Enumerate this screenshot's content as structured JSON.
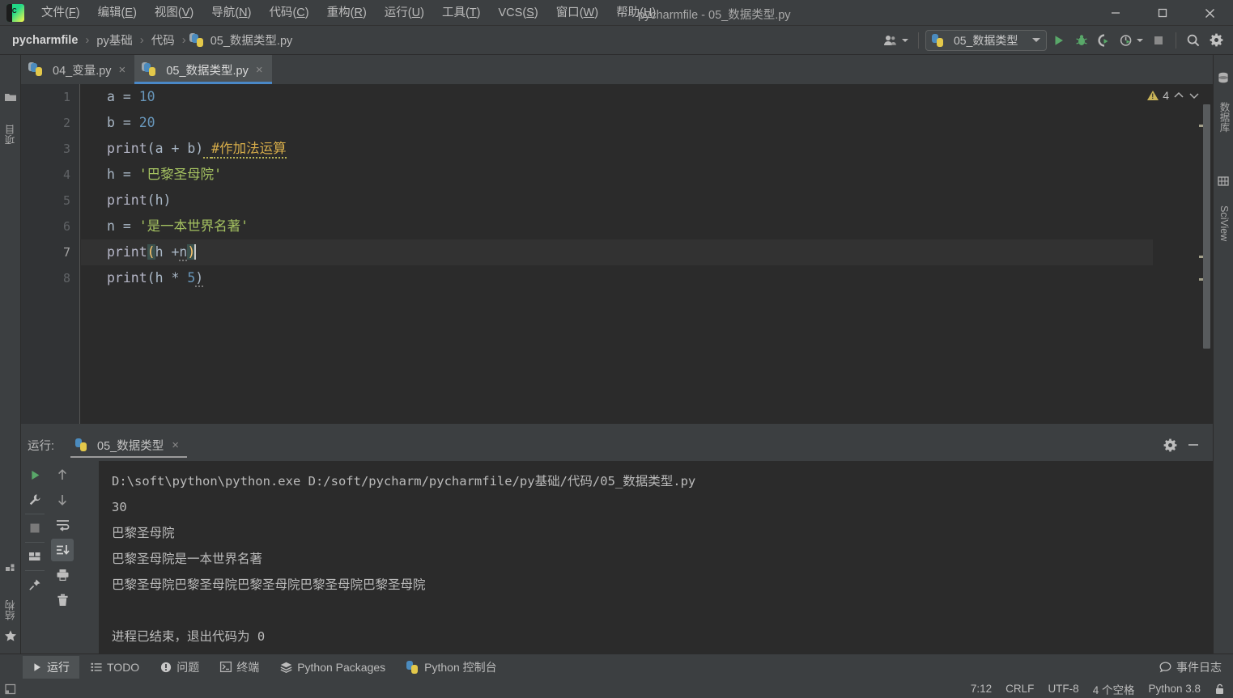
{
  "window": {
    "title": "pycharmfile - 05_数据类型.py",
    "app_icon": "pycharm-logo-icon",
    "controls": {
      "minimize": "minimize-icon",
      "maximize": "maximize-icon",
      "close": "close-icon"
    }
  },
  "menubar": {
    "items": [
      {
        "text": "文件",
        "mnemonic": "F"
      },
      {
        "text": "编辑",
        "mnemonic": "E"
      },
      {
        "text": "视图",
        "mnemonic": "V"
      },
      {
        "text": "导航",
        "mnemonic": "N"
      },
      {
        "text": "代码",
        "mnemonic": "C"
      },
      {
        "text": "重构",
        "mnemonic": "R"
      },
      {
        "text": "运行",
        "mnemonic": "U"
      },
      {
        "text": "工具",
        "mnemonic": "T"
      },
      {
        "text": "VCS",
        "mnemonic": "S"
      },
      {
        "text": "窗口",
        "mnemonic": "W"
      },
      {
        "text": "帮助",
        "mnemonic": "H"
      }
    ]
  },
  "breadcrumb": {
    "separator": "›",
    "items": [
      {
        "label": "pycharmfile",
        "root": true
      },
      {
        "label": "py基础",
        "root": false
      },
      {
        "label": "代码",
        "root": false
      },
      {
        "label": "05_数据类型.py",
        "root": false,
        "icon": "python-file-icon"
      }
    ]
  },
  "toolbar": {
    "account_icon": "user-account-icon",
    "run_config": {
      "label": "05_数据类型",
      "icon": "python-file-icon"
    },
    "run_icon": "run-play-icon",
    "debug_icon": "debug-bug-icon",
    "run_coverage_icon": "run-with-coverage-icon",
    "profile_icon": "profile-icon",
    "stop_icon": "stop-square-icon",
    "search_icon": "search-magnifier-icon",
    "settings_icon": "settings-gear-icon"
  },
  "left_strip": {
    "project_label": "项目",
    "project_icon": "project-folder-icon",
    "structure_label": "结构",
    "structure_icon": "structure-blocks-icon",
    "favorites_label": "收藏夹",
    "favorites_icon": "favorites-star-icon"
  },
  "right_strip": {
    "database_label": "数据库",
    "database_icon": "database-cylinder-icon",
    "sciview_label": "SciView",
    "sciview_icon": "sciview-grid-icon"
  },
  "editor_tabs": [
    {
      "label": "04_变量.py",
      "active": false,
      "icon": "python-file-icon",
      "close": "×"
    },
    {
      "label": "05_数据类型.py",
      "active": true,
      "icon": "python-file-icon",
      "close": "×"
    }
  ],
  "editor": {
    "line_numbers": [
      "1",
      "2",
      "3",
      "4",
      "5",
      "6",
      "7",
      "8"
    ],
    "current_line": 7,
    "inspection": {
      "warning_count": "4",
      "warning_icon": "warning-triangle-icon",
      "up_icon": "⌃",
      "down_icon": "⌄"
    },
    "lines": [
      {
        "n": 1,
        "raw": "a = 10"
      },
      {
        "n": 2,
        "raw": "b = 20"
      },
      {
        "n": 3,
        "raw": "print(a + b) #作加法运算"
      },
      {
        "n": 4,
        "raw": "h = '巴黎圣母院'"
      },
      {
        "n": 5,
        "raw": "print(h)"
      },
      {
        "n": 6,
        "raw": "n = '是一本世界名著'"
      },
      {
        "n": 7,
        "raw": "print(h +n)"
      },
      {
        "n": 8,
        "raw": "print(h * 5)"
      }
    ],
    "tokens": {
      "l1_var": "a",
      "l1_eq": " = ",
      "l1_num": "10",
      "l2_var": "b",
      "l2_eq": " = ",
      "l2_num": "20",
      "l3_fn": "print",
      "l3_args": "(a + b)",
      "l3_gap": " ",
      "l3_comment": "#作加法运算",
      "l4_var": "h",
      "l4_eq": " = ",
      "l4_str": "'巴黎圣母院'",
      "l5_fn": "print",
      "l5_args": "(h)",
      "l6_var": "n",
      "l6_eq": " = ",
      "l6_str": "'是一本世界名著'",
      "l7_fn": "print",
      "l7_open": "(",
      "l7_mid": "h +",
      "l7_n": "n",
      "l7_close": ")",
      "l8_fn": "print",
      "l8_open": "(h ",
      "l8_star": "* ",
      "l8_num": "5",
      "l8_close": ")"
    }
  },
  "run_panel": {
    "title": "运行:",
    "tab_label": "05_数据类型",
    "tab_icon": "python-file-icon",
    "tab_close": "×",
    "settings_icon": "settings-gear-icon",
    "minimize_icon": "minimize-panel-icon",
    "tools": {
      "rerun_icon": "rerun-play-icon",
      "config_icon": "wrench-icon",
      "stop_icon": "stop-square-icon",
      "layout_icon": "layout-blocks-icon",
      "pin_icon": "pin-icon",
      "up_icon": "arrow-up-icon",
      "down_icon": "arrow-down-icon",
      "soft_wrap_icon": "soft-wrap-icon",
      "scroll_end_icon": "scroll-to-end-icon",
      "print_icon": "printer-icon",
      "clear_icon": "trash-icon"
    },
    "console_output": [
      "D:\\soft\\python\\python.exe D:/soft/pycharm/pycharmfile/py基础/代码/05_数据类型.py",
      "30",
      "巴黎圣母院",
      "巴黎圣母院是一本世界名著",
      "巴黎圣母院巴黎圣母院巴黎圣母院巴黎圣母院巴黎圣母院",
      "",
      "进程已结束，退出代码为 0"
    ]
  },
  "tool_window_bar": {
    "items": [
      {
        "label": "运行",
        "icon": "run-play-icon",
        "active": true
      },
      {
        "label": "TODO",
        "icon": "todo-list-icon",
        "active": false
      },
      {
        "label": "问题",
        "icon": "problems-warning-icon",
        "active": false
      },
      {
        "label": "终端",
        "icon": "terminal-icon",
        "active": false
      },
      {
        "label": "Python Packages",
        "icon": "packages-layers-icon",
        "active": false
      },
      {
        "label": "Python 控制台",
        "icon": "python-console-icon",
        "active": false
      }
    ],
    "event_log": {
      "label": "事件日志",
      "icon": "event-log-balloon-icon"
    }
  },
  "status_bar": {
    "caret_position": "7:12",
    "line_separator": "CRLF",
    "encoding": "UTF-8",
    "indent": "4 个空格",
    "interpreter": "Python 3.8",
    "lock_icon": "unlocked-padlock-icon"
  },
  "colors": {
    "bg_chrome": "#3c3f41",
    "bg_editor": "#2b2b2b",
    "gutter": "#313335",
    "accent_blue": "#4a88c7",
    "text": "#bbbbbb",
    "string_green": "#a5c261",
    "number_blue": "#6897bb",
    "comment_yellow": "#d7ad4a",
    "bracket_yellow": "#ffc66d",
    "run_green": "#59a869"
  }
}
